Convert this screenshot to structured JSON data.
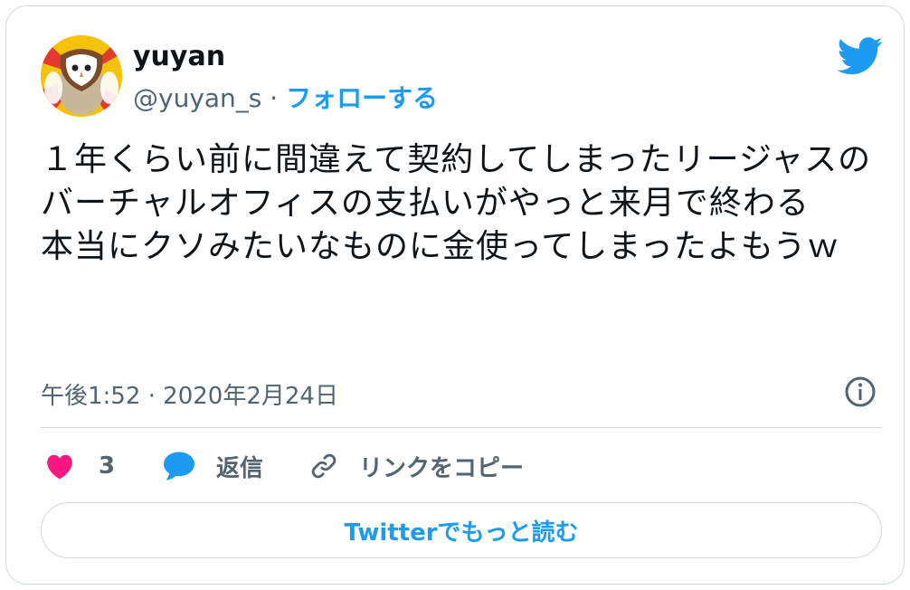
{
  "user": {
    "name": "yuyan",
    "handle": "@yuyan_s",
    "separator": "·",
    "follow_label": "フォローする"
  },
  "tweet": {
    "text": "１年くらい前に間違えて契約してしまったリージャスのバーチャルオフィスの支払いがやっと来月で終わる\n本当にクソみたいなものに金使ってしまったよもうｗ",
    "timestamp": "午後1:52 · 2020年2月24日"
  },
  "actions": {
    "like_count": "3",
    "reply_label": "返信",
    "copy_link_label": "リンクをコピー"
  },
  "read_more_label": "Twitterでもっと読む",
  "icons": {
    "brand": "twitter-bird-icon",
    "info": "info-icon",
    "like": "heart-icon",
    "reply": "reply-bubble-icon",
    "link": "link-icon"
  },
  "colors": {
    "accent": "#1d9bf0",
    "like": "#f91880",
    "text": "#0f1419",
    "muted": "#536471",
    "border": "#cfd9de"
  }
}
